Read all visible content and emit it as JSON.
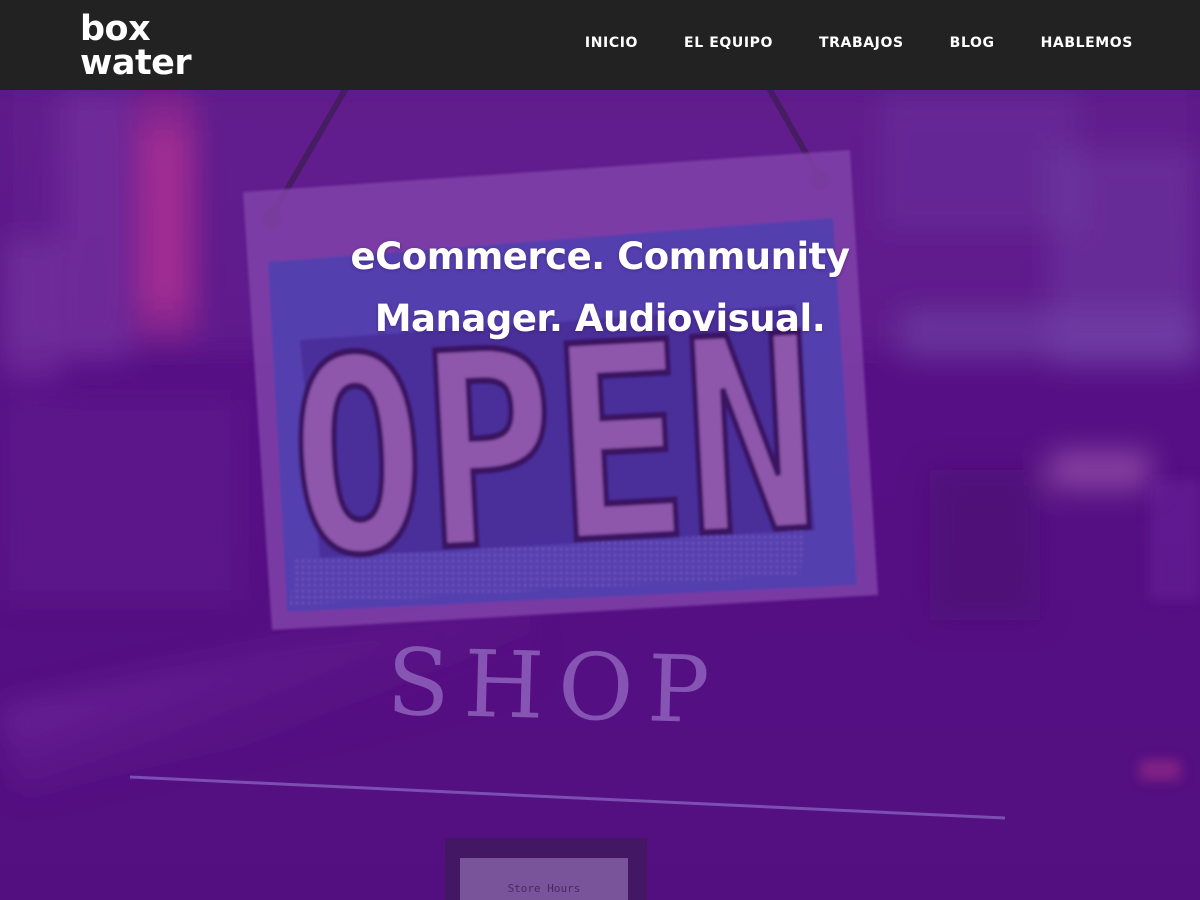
{
  "header": {
    "logo": {
      "line1": "box",
      "line2": "water"
    },
    "nav": [
      {
        "label": "INICIO"
      },
      {
        "label": "EL EQUIPO"
      },
      {
        "label": "TRABAJOS"
      },
      {
        "label": "BLOG"
      },
      {
        "label": "HABLEMOS"
      }
    ]
  },
  "hero": {
    "heading_line1": "eCommerce. Community",
    "heading_line2": "Manager. Audiovisual.",
    "image": {
      "sign_text": "OPEN",
      "door_text": "SHOP",
      "small_sign_text": "Store Hours",
      "overlay_color": "#5a118a"
    }
  },
  "colors": {
    "header_bg": "#222222",
    "nav_text": "#ffffff",
    "hero_overlay": "#5a118a"
  }
}
